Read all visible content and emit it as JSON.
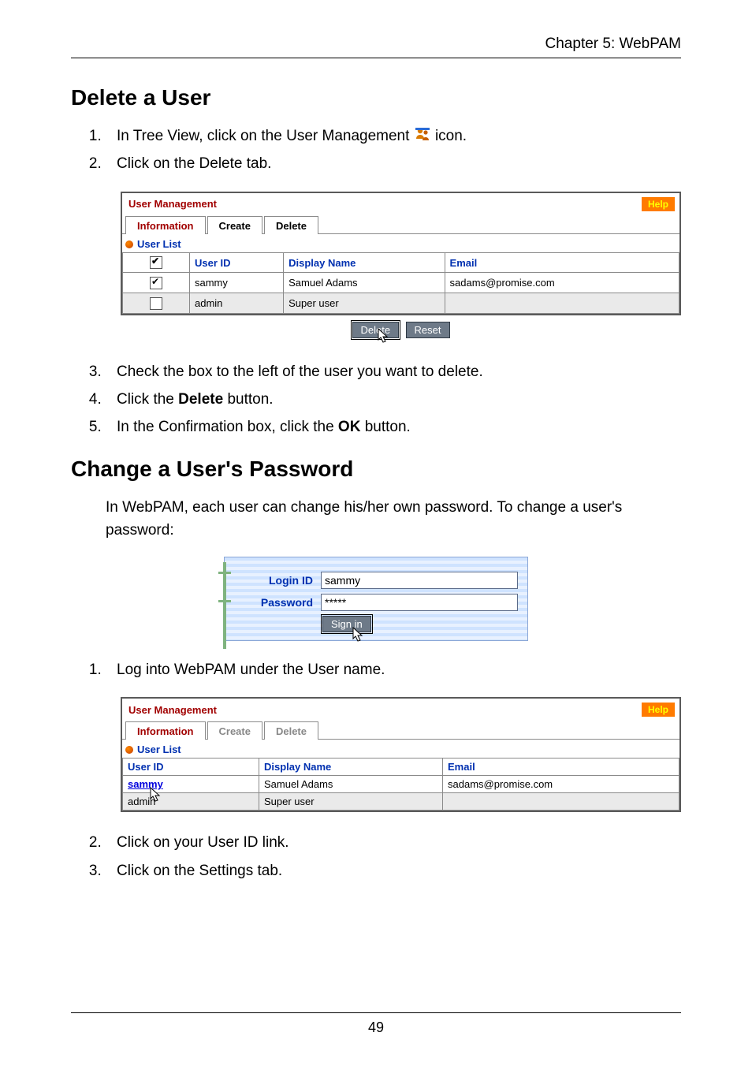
{
  "header": {
    "chapter": "Chapter 5: WebPAM"
  },
  "sections": {
    "delete_user": {
      "title": "Delete a User"
    },
    "change_pw": {
      "title": "Change a User's Password"
    }
  },
  "steps_delete_a": [
    {
      "pre": "In Tree View, click on the User Management ",
      "post": " icon."
    },
    {
      "pre": "Click on the Delete tab.",
      "post": ""
    }
  ],
  "steps_delete_b": [
    "Check the box to the left of the user you want to delete.",
    "Click the Delete button.",
    "In the Confirmation box, click the OK button."
  ],
  "steps_delete_b_bold": {
    "1": "Delete",
    "2": "OK"
  },
  "change_pw_intro": "In WebPAM, each user can change his/her own password. To change a user's password:",
  "steps_change": [
    "Log into WebPAM under the User name.",
    "Click on your User ID link.",
    "Click on the Settings tab."
  ],
  "panel_delete": {
    "title": "User Management",
    "help": "Help",
    "tabs": [
      "Information",
      "Create",
      "Delete"
    ],
    "active_tab": 2,
    "subhead": "User List",
    "columns": [
      "",
      "User ID",
      "Display Name",
      "Email"
    ],
    "rows": [
      {
        "checked": true,
        "user_id": "sammy",
        "display": "Samuel Adams",
        "email": "sadams@promise.com"
      },
      {
        "checked": false,
        "user_id": "admin",
        "display": "Super user",
        "email": ""
      }
    ],
    "buttons": {
      "delete": "Delete",
      "reset": "Reset"
    }
  },
  "login": {
    "labels": {
      "login_id": "Login ID",
      "password": "Password"
    },
    "values": {
      "login_id": "sammy",
      "password": "*****"
    },
    "button": "Sign in"
  },
  "panel_info": {
    "title": "User Management",
    "help": "Help",
    "tabs": [
      "Information",
      "Create",
      "Delete"
    ],
    "active_tab": 0,
    "subhead": "User List",
    "columns": [
      "User ID",
      "Display Name",
      "Email"
    ],
    "rows": [
      {
        "user_id": "sammy",
        "display": "Samuel Adams",
        "email": "sadams@promise.com",
        "link": true
      },
      {
        "user_id": "admin",
        "display": "Super user",
        "email": "",
        "link": false
      }
    ]
  },
  "footer": {
    "page_number": "49"
  },
  "icons": {
    "user_management": "user-management-icon"
  }
}
